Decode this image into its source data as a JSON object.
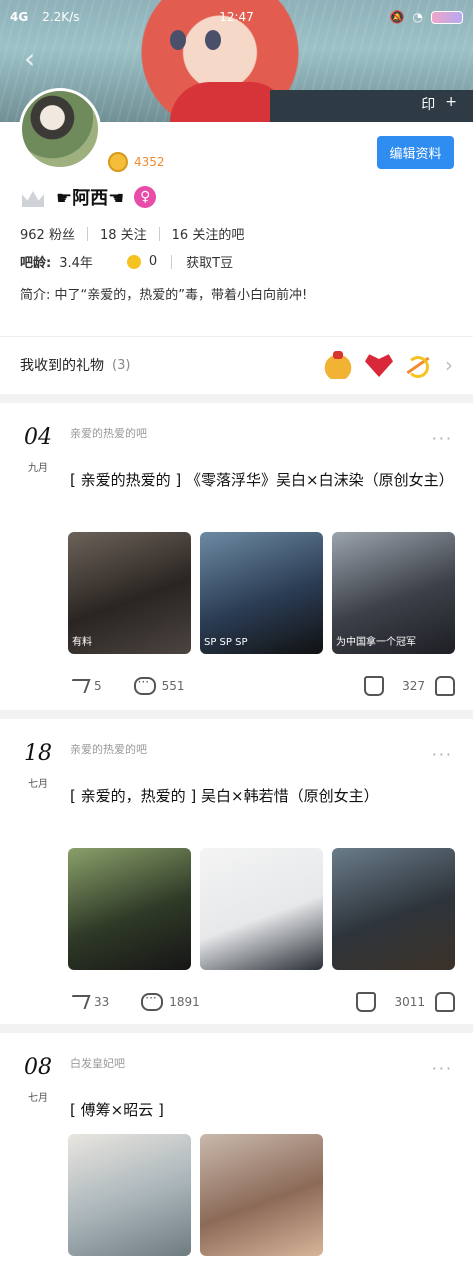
{
  "status_bar": {
    "signal": "4G",
    "speed": "2.2K/s",
    "time": "12:47",
    "battery": "64%"
  },
  "banner": {
    "buttons": [
      "印",
      "+"
    ]
  },
  "profile": {
    "username": "☛阿西☚",
    "coins": "4352",
    "edit_button": "编辑资料",
    "stats": {
      "fans": "962 粉丝",
      "following": "18 关注",
      "followed_bars": "16 关注的吧"
    },
    "bar_age_label": "吧龄:",
    "bar_age_value": "3.4年",
    "beans": "0",
    "get_tdou": "获取T豆",
    "bio": "简介: 中了“亲爱的，热爱的”毒，带着小白向前冲!"
  },
  "gifts": {
    "title": "我收到的礼物",
    "count": "(3)"
  },
  "posts": [
    {
      "day": "04",
      "month": "九月",
      "forum": "亲爱的热爱的吧",
      "title": "[ 亲爱的热爱的 ] 《零落浮华》吴白×白沫染（原创女主）",
      "captions": [
        "有料",
        "SP SP SP",
        "为中国拿一个冠军"
      ],
      "shares": "5",
      "comments": "551",
      "likes": "327"
    },
    {
      "day": "18",
      "month": "七月",
      "forum": "亲爱的热爱的吧",
      "title": "[ 亲爱的，热爱的 ] 吴白×韩若惜（原创女主）",
      "captions": [
        "",
        "",
        ""
      ],
      "shares": "33",
      "comments": "1891",
      "likes": "3011"
    },
    {
      "day": "08",
      "month": "七月",
      "forum": "白发皇妃吧",
      "title": "[ 傅筹×昭云 ]",
      "captions": [
        "",
        ""
      ]
    }
  ],
  "colors": {
    "accent": "#2f8cf0",
    "coin": "#f08a2c",
    "gender": "#e84ba8"
  }
}
